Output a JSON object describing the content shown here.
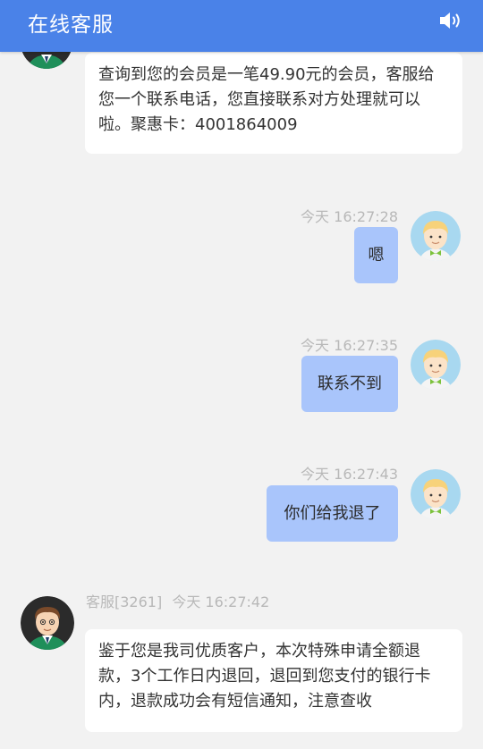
{
  "header": {
    "title": "在线客服",
    "speaker_icon": "speaker-icon",
    "bg_color": "#4a82e8"
  },
  "messages": [
    {
      "from": "agent",
      "text": "查询到您的会员是一笔49.90元的会员，客服给您一个联系电话，您直接联系对方处理就可以啦。聚惠卡：4001864009"
    },
    {
      "from": "user",
      "time": "今天 16:27:28",
      "text": "嗯"
    },
    {
      "from": "user",
      "time": "今天 16:27:35",
      "text": "联系不到"
    },
    {
      "from": "user",
      "time": "今天 16:27:43",
      "text": "你们给我退了"
    },
    {
      "from": "agent",
      "sender": "客服[3261]",
      "time": "今天 16:27:42",
      "text": "鉴于您是我司优质客户，本次特殊申请全额退款，3个工作日内退回，退回到您支付的银行卡内，退款成功会有短信通知，注意查收"
    }
  ],
  "colors": {
    "user_bubble": "#a9c5fb",
    "agent_bubble": "#ffffff",
    "background": "#f2f2f2"
  }
}
